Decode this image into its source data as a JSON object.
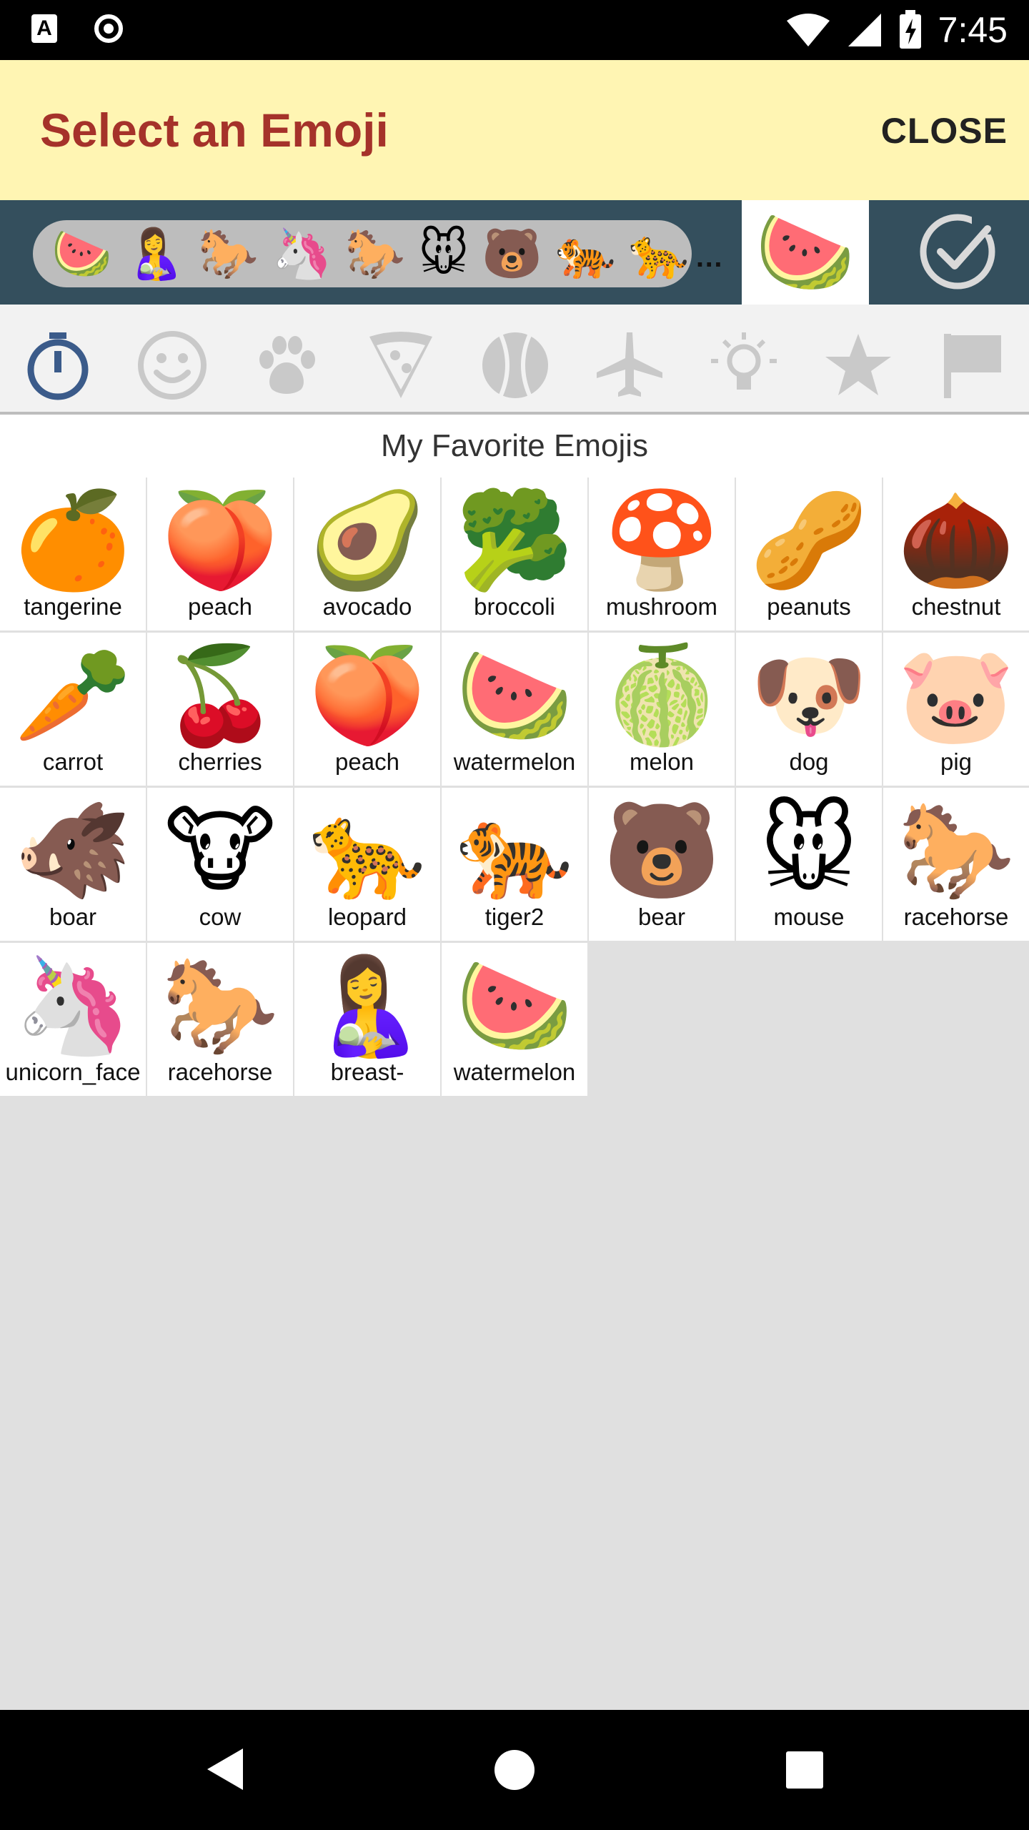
{
  "status_bar": {
    "time": "7:45"
  },
  "header": {
    "title": "Select an Emoji",
    "close_label": "CLOSE"
  },
  "recent_emojis": [
    "🍉",
    "🤱",
    "🐎",
    "🦄",
    "🐎",
    "🐭",
    "🐻",
    "🐅",
    "🐆"
  ],
  "recent_more": "…",
  "selected_emoji": "🍉",
  "category_tabs": [
    {
      "name": "recent-tab-icon",
      "active": true
    },
    {
      "name": "smiley-tab-icon",
      "active": false
    },
    {
      "name": "paw-tab-icon",
      "active": false
    },
    {
      "name": "pizza-tab-icon",
      "active": false
    },
    {
      "name": "ball-tab-icon",
      "active": false
    },
    {
      "name": "airplane-tab-icon",
      "active": false
    },
    {
      "name": "lightbulb-tab-icon",
      "active": false
    },
    {
      "name": "star-tab-icon",
      "active": false
    },
    {
      "name": "flag-tab-icon",
      "active": false
    }
  ],
  "section_title": "My Favorite Emojis",
  "favorites": [
    {
      "emoji": "🍊",
      "label": "tangerine"
    },
    {
      "emoji": "🍑",
      "label": "peach"
    },
    {
      "emoji": "🥑",
      "label": "avocado"
    },
    {
      "emoji": "🥦",
      "label": "broccoli"
    },
    {
      "emoji": "🍄",
      "label": "mushroom"
    },
    {
      "emoji": "🥜",
      "label": "peanuts"
    },
    {
      "emoji": "🌰",
      "label": "chestnut"
    },
    {
      "emoji": "🥕",
      "label": "carrot"
    },
    {
      "emoji": "🍒",
      "label": "cherries"
    },
    {
      "emoji": "🍑",
      "label": "peach"
    },
    {
      "emoji": "🍉",
      "label": "watermelon"
    },
    {
      "emoji": "🍈",
      "label": "melon"
    },
    {
      "emoji": "🐶",
      "label": "dog"
    },
    {
      "emoji": "🐷",
      "label": "pig"
    },
    {
      "emoji": "🐗",
      "label": "boar"
    },
    {
      "emoji": "🐮",
      "label": "cow"
    },
    {
      "emoji": "🐆",
      "label": "leopard"
    },
    {
      "emoji": "🐅",
      "label": "tiger2"
    },
    {
      "emoji": "🐻",
      "label": "bear"
    },
    {
      "emoji": "🐭",
      "label": "mouse"
    },
    {
      "emoji": "🐎",
      "label": "racehorse"
    },
    {
      "emoji": "🦄",
      "label": "unicorn_face"
    },
    {
      "emoji": "🐎",
      "label": "racehorse"
    },
    {
      "emoji": "🤱",
      "label": "breast-"
    },
    {
      "emoji": "🍉",
      "label": "watermelon"
    }
  ],
  "colors": {
    "header_bg": "#fff5b3",
    "title": "#a5322a",
    "toolbar_bg": "#344f5d",
    "active_tab": "#3b5b8a",
    "inactive_tab": "#c9c9c9"
  }
}
